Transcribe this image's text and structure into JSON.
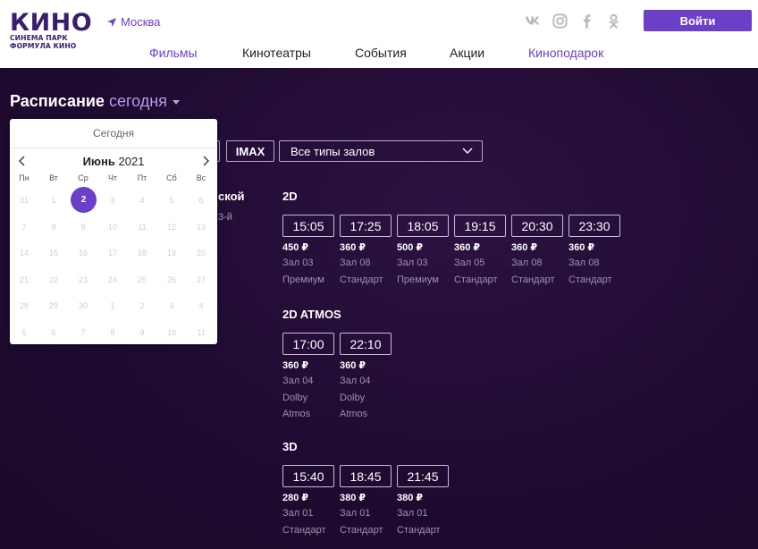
{
  "header": {
    "logo": {
      "main": "КИНО",
      "line1": "СИНЕМА ПАРК",
      "line2": "ФОРМУЛА КИНО"
    },
    "city": "Москва",
    "nav": [
      {
        "label": "Фильмы",
        "active": true
      },
      {
        "label": "Кинотеатры",
        "active": false
      },
      {
        "label": "События",
        "active": false
      },
      {
        "label": "Акции",
        "active": false
      },
      {
        "label": "Киноподарок",
        "active": true
      }
    ],
    "socials": [
      "vk-icon",
      "instagram-icon",
      "facebook-icon",
      "odnoklassniki-icon"
    ],
    "login_label": "Войти"
  },
  "schedule": {
    "title": "Расписание",
    "day": "сегодня",
    "filters": {
      "imax": "IMAX",
      "halls": "Все типы залов"
    },
    "cinema": {
      "name_fragment": "ской",
      "floor_fragment": "3-й"
    }
  },
  "calendar": {
    "today_label": "Сегодня",
    "month": "Июнь",
    "year": "2021",
    "weekdays": [
      "Пн",
      "Вт",
      "Ср",
      "Чт",
      "Пт",
      "Сб",
      "Вс"
    ],
    "weeks": [
      [
        "31",
        "1",
        "2",
        "3",
        "4",
        "5",
        "6"
      ],
      [
        "7",
        "8",
        "9",
        "10",
        "11",
        "12",
        "13"
      ],
      [
        "14",
        "15",
        "16",
        "17",
        "18",
        "19",
        "20"
      ],
      [
        "21",
        "22",
        "23",
        "24",
        "25",
        "26",
        "27"
      ],
      [
        "28",
        "29",
        "30",
        "1",
        "2",
        "3",
        "4"
      ],
      [
        "5",
        "6",
        "7",
        "8",
        "9",
        "10",
        "11"
      ]
    ],
    "selected": "2"
  },
  "sessions": [
    {
      "format": "2D",
      "shows": [
        {
          "time": "15:05",
          "price": "450 ₽",
          "hall": "Зал 03",
          "type": "Премиум"
        },
        {
          "time": "17:25",
          "price": "360 ₽",
          "hall": "Зал 08",
          "type": "Стандарт"
        },
        {
          "time": "18:05",
          "price": "500 ₽",
          "hall": "Зал 03",
          "type": "Премиум"
        },
        {
          "time": "19:15",
          "price": "360 ₽",
          "hall": "Зал 05",
          "type": "Стандарт"
        },
        {
          "time": "20:30",
          "price": "360 ₽",
          "hall": "Зал 08",
          "type": "Стандарт"
        },
        {
          "time": "23:30",
          "price": "360 ₽",
          "hall": "Зал 08",
          "type": "Стандарт"
        }
      ]
    },
    {
      "format": "2D ATMOS",
      "shows": [
        {
          "time": "17:00",
          "price": "360 ₽",
          "hall": "Зал 04",
          "type": "Dolby Atmos"
        },
        {
          "time": "22:10",
          "price": "360 ₽",
          "hall": "Зал 04",
          "type": "Dolby Atmos"
        }
      ]
    },
    {
      "format": "3D",
      "shows": [
        {
          "time": "15:40",
          "price": "280 ₽",
          "hall": "Зал 01",
          "type": "Стандарт"
        },
        {
          "time": "18:45",
          "price": "380 ₽",
          "hall": "Зал 01",
          "type": "Стандарт"
        },
        {
          "time": "21:45",
          "price": "380 ₽",
          "hall": "Зал 01",
          "type": "Стандарт"
        }
      ]
    }
  ]
}
